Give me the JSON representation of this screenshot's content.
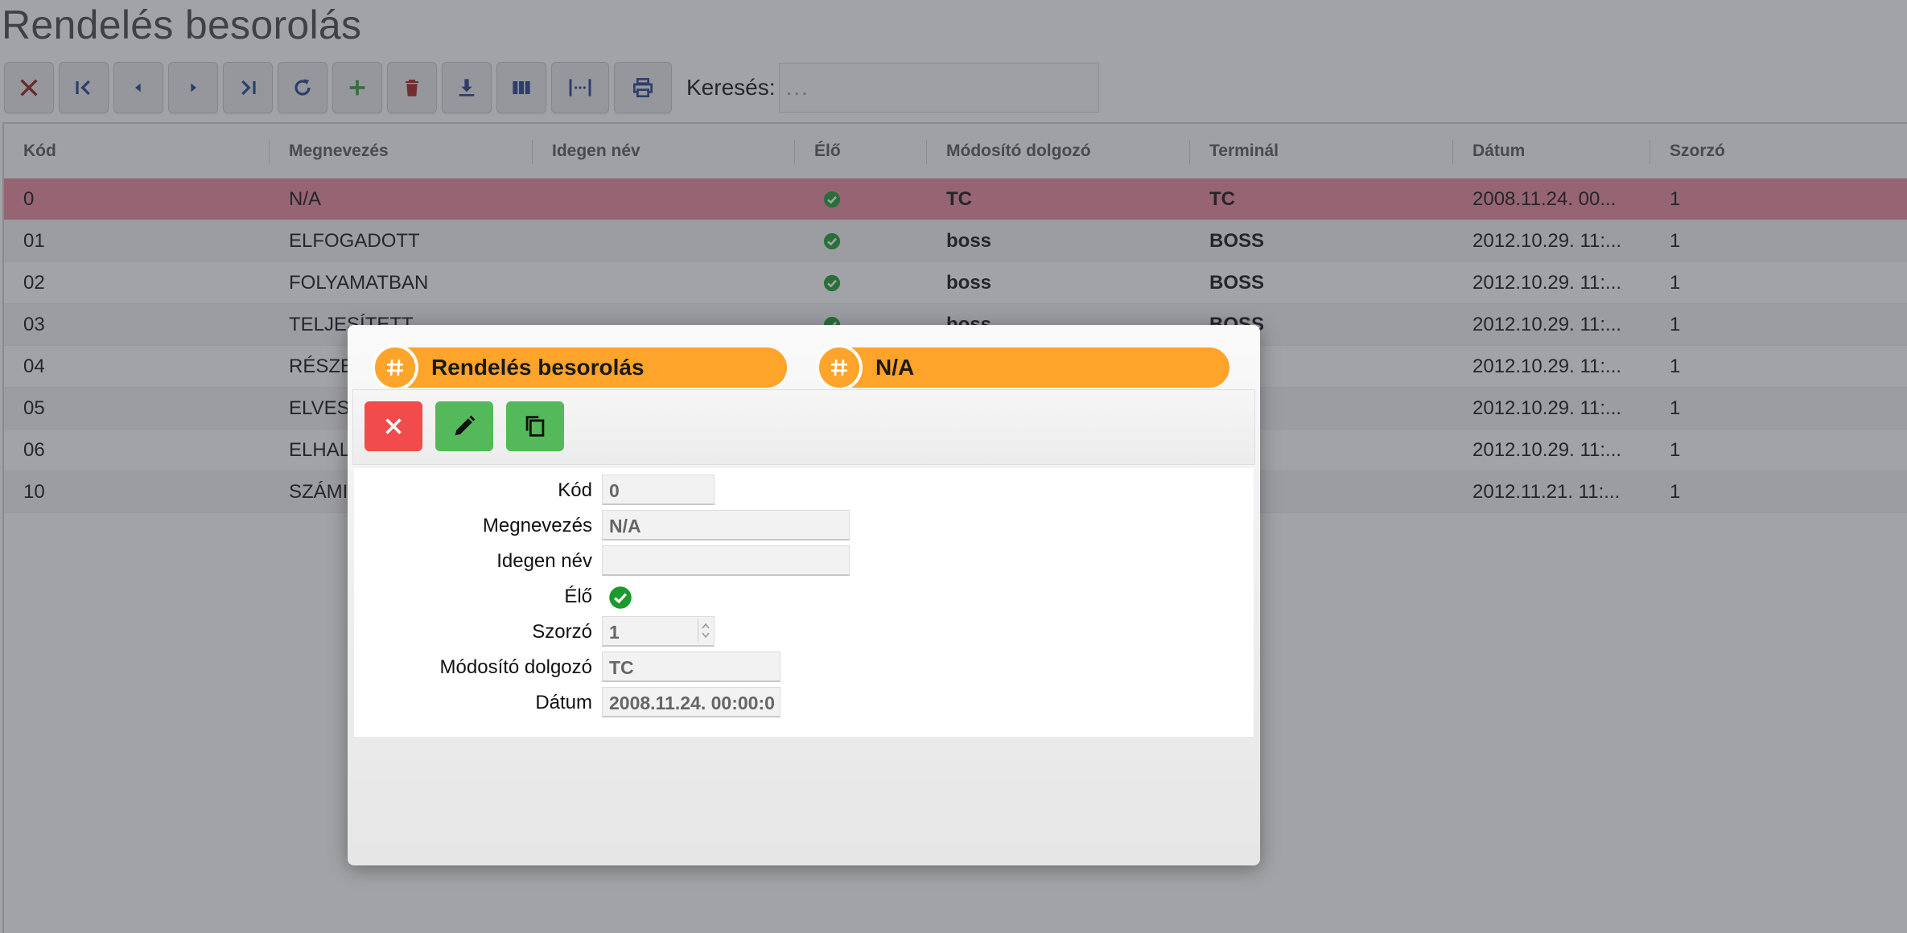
{
  "page": {
    "title": "Rendelés besorolás"
  },
  "toolbar": {
    "buttons": [
      "close-icon",
      "first-page-icon",
      "prev-icon",
      "next-icon",
      "last-page-icon",
      "refresh-icon",
      "add-icon",
      "delete-icon",
      "download-icon",
      "columns-icon",
      "fit-width-icon",
      "print-icon"
    ],
    "search_label": "Keresés:",
    "search_placeholder": "..."
  },
  "grid": {
    "headers": [
      "Kód",
      "Megnevezés",
      "Idegen név",
      "Élő",
      "Módosító dolgozó",
      "Terminál",
      "Dátum",
      "Szorzó"
    ],
    "rows": [
      {
        "kod": "0",
        "megnevezes": "N/A",
        "idegen": "",
        "elo": true,
        "modosito": "TC",
        "terminal": "TC",
        "datum": "2008.11.24. 00...",
        "szorzo": "1",
        "selected": true
      },
      {
        "kod": "01",
        "megnevezes": "ELFOGADOTT",
        "idegen": "",
        "elo": true,
        "modosito": "boss",
        "terminal": "BOSS",
        "datum": "2012.10.29. 11:...",
        "szorzo": "1"
      },
      {
        "kod": "02",
        "megnevezes": "FOLYAMATBAN",
        "idegen": "",
        "elo": true,
        "modosito": "boss",
        "terminal": "BOSS",
        "datum": "2012.10.29. 11:...",
        "szorzo": "1"
      },
      {
        "kod": "03",
        "megnevezes": "TELJESÍTETT",
        "idegen": "",
        "elo": true,
        "modosito": "boss",
        "terminal": "BOSS",
        "datum": "2012.10.29. 11:...",
        "szorzo": "1"
      },
      {
        "kod": "04",
        "megnevezes": "RÉSZE",
        "idegen": "",
        "elo": true,
        "modosito": "",
        "terminal": "",
        "datum": "2012.10.29. 11:...",
        "szorzo": "1"
      },
      {
        "kod": "05",
        "megnevezes": "ELVES",
        "idegen": "",
        "elo": true,
        "modosito": "",
        "terminal": "",
        "datum": "2012.10.29. 11:...",
        "szorzo": "1"
      },
      {
        "kod": "06",
        "megnevezes": "ELHAL",
        "idegen": "",
        "elo": true,
        "modosito": "",
        "terminal": "",
        "datum": "2012.10.29. 11:...",
        "szorzo": "1"
      },
      {
        "kod": "10",
        "megnevezes": "SZÁMI",
        "idegen": "",
        "elo": true,
        "modosito": "",
        "terminal": "",
        "datum": "2012.11.21. 11:...",
        "szorzo": "1"
      }
    ]
  },
  "modal": {
    "pill_left": "Rendelés besorolás",
    "pill_right": "N/A",
    "actions": [
      "close-icon",
      "edit-icon",
      "copy-icon"
    ],
    "fields": [
      {
        "label": "Kód",
        "value": "0"
      },
      {
        "label": "Megnevezés",
        "value": "N/A"
      },
      {
        "label": "Idegen név",
        "value": ""
      },
      {
        "label": "Élő",
        "value": ""
      },
      {
        "label": "Szorzó",
        "value": "1"
      },
      {
        "label": "Módosító dolgozó",
        "value": "TC"
      },
      {
        "label": "Dátum",
        "value": "2008.11.24. 00:00:0"
      }
    ]
  },
  "colors": {
    "accent": "#ffa42a",
    "selected_row": "#e8879a",
    "check": "#1a9b2e",
    "danger": "#f14b4b",
    "success": "#54b95a",
    "icon": "#1f3f8a"
  }
}
